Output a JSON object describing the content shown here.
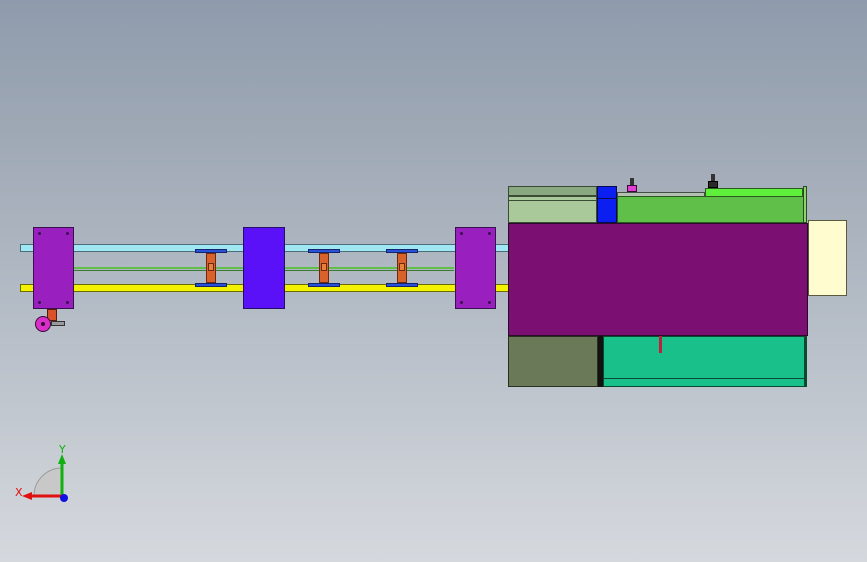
{
  "viewport": {
    "background_top": "#8f9bac",
    "background_bottom": "#d5d9de"
  },
  "model": {
    "colors": {
      "cyan_rod": "#9fe7f2",
      "yellow_rod": "#f3f300",
      "end_plate": "#9a1fbf",
      "center_plate": "#5a11f7",
      "main_body": "#7b1072",
      "cream_block": "#fffcd0",
      "light_green_block": "#a9c99a",
      "bright_green_block": "#5fbf48",
      "olive_block": "#6a7a58",
      "teal_block": "#19c08a",
      "blue_block": "#0a1ff0",
      "ibeam_flange": "#2a4fd8",
      "ibeam_web": "#d9612a"
    },
    "ibeam_count": 3,
    "plate_count": 3
  },
  "triad": {
    "x_label": "X",
    "y_label": "Y",
    "x_color": "#e01010",
    "y_color": "#10b010",
    "z_color": "#1010e0"
  }
}
